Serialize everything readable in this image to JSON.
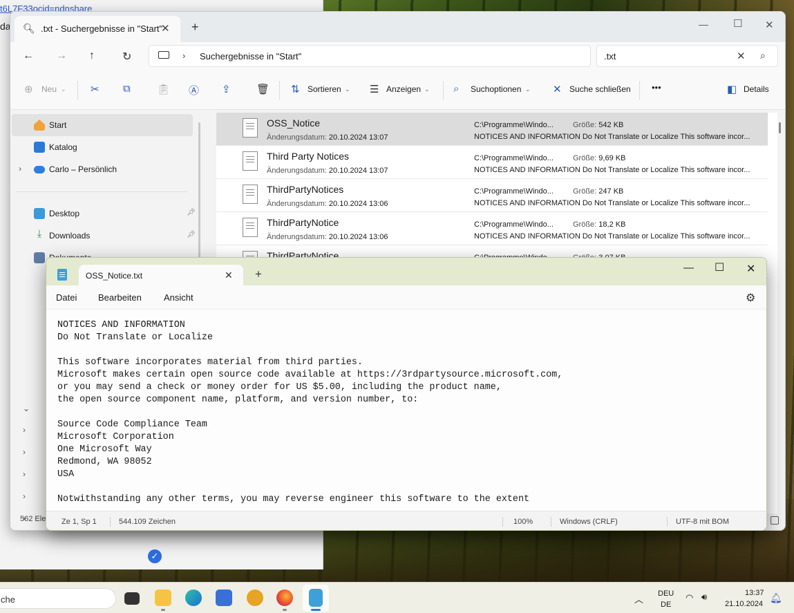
{
  "background_window": {
    "link_text": "t6L7F33ocid=ndnshare",
    "text": "da"
  },
  "explorer": {
    "tab": {
      "title": ".txt - Suchergebnisse in \"Start\""
    },
    "address": {
      "path": "Suchergebnisse in \"Start\""
    },
    "search": {
      "value": ".txt"
    },
    "commands": {
      "new": "Neu",
      "sort": "Sortieren",
      "view": "Anzeigen",
      "search_options": "Suchoptionen",
      "close_search": "Suche schließen",
      "more": "•••",
      "details": "Details"
    },
    "sidebar": {
      "start": "Start",
      "katalog": "Katalog",
      "onedrive": "Carlo – Persönlich",
      "desktop": "Desktop",
      "downloads": "Downloads",
      "documents": "Dokumente"
    },
    "results": [
      {
        "name": "OSS_Notice",
        "date_label": "Änderungsdatum:",
        "date": "20.10.2024 13:07",
        "path": "C:\\Programme\\Windo...",
        "size_label": "Größe:",
        "size": "542 KB",
        "snippet": "NOTICES AND INFORMATION Do Not Translate or Localize This software incor..."
      },
      {
        "name": "Third Party Notices",
        "date_label": "Änderungsdatum:",
        "date": "20.10.2024 13:07",
        "path": "C:\\Programme\\Windo...",
        "size_label": "Größe:",
        "size": "9,69 KB",
        "snippet": "NOTICES AND INFORMATION Do Not Translate or Localize This software incor..."
      },
      {
        "name": "ThirdPartyNotices",
        "date_label": "Änderungsdatum:",
        "date": "20.10.2024 13:06",
        "path": "C:\\Programme\\Windo...",
        "size_label": "Größe:",
        "size": "247 KB",
        "snippet": "NOTICES AND INFORMATION Do Not Translate or Localize This software incor..."
      },
      {
        "name": "ThirdPartyNotice",
        "date_label": "Änderungsdatum:",
        "date": "20.10.2024 13:06",
        "path": "C:\\Programme\\Windo...",
        "size_label": "Größe:",
        "size": "18,2 KB",
        "snippet": "NOTICES AND INFORMATION Do Not Translate or Localize This software incor..."
      },
      {
        "name": "ThirdPartyNotice",
        "date_label": "",
        "date": "",
        "path": "C:\\Programme\\Windo...",
        "size_label": "Größe:",
        "size": "3,07 KB",
        "snippet": ""
      }
    ],
    "status": "562 Ele"
  },
  "notepad": {
    "tab_title": "OSS_Notice.txt",
    "menu": {
      "file": "Datei",
      "edit": "Bearbeiten",
      "view": "Ansicht"
    },
    "content": "NOTICES AND INFORMATION\nDo Not Translate or Localize\n\nThis software incorporates material from third parties.\nMicrosoft makes certain open source code available at https://3rdpartysource.microsoft.com,\nor you may send a check or money order for US $5.00, including the product name,\nthe open source component name, platform, and version number, to:\n\nSource Code Compliance Team\nMicrosoft Corporation\nOne Microsoft Way\nRedmond, WA 98052\nUSA\n\nNotwithstanding any other terms, you may reverse engineer this software to the extent",
    "status": {
      "position": "Ze 1, Sp 1",
      "chars": "544.109 Zeichen",
      "zoom": "100%",
      "line_ending": "Windows (CRLF)",
      "encoding": "UTF-8 mit BOM"
    }
  },
  "taskbar": {
    "search_text": "che",
    "lang_top": "DEU",
    "lang_bottom": "DE",
    "time": "13:37",
    "date": "21.10.2024"
  }
}
